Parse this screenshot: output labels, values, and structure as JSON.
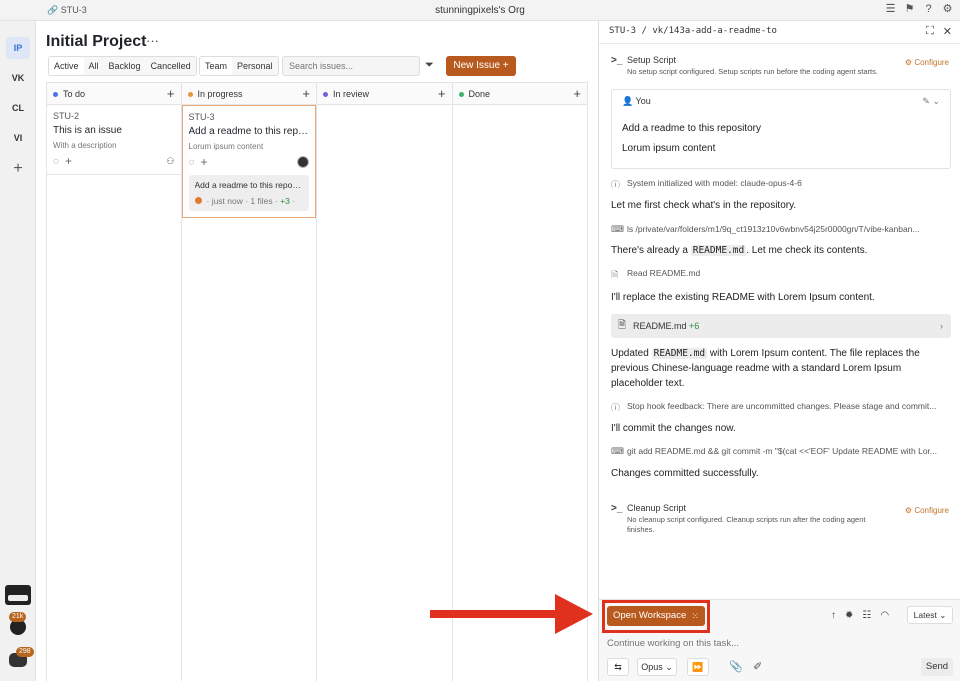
{
  "topbar": {
    "crumb": "STU-3",
    "org": "stunningpixels's Org",
    "icons": [
      "menu-icon",
      "flag-icon",
      "help-icon",
      "settings-icon"
    ]
  },
  "rail": {
    "items": [
      "IP",
      "VK",
      "CL",
      "VI"
    ],
    "github_badge": "21k",
    "discord_badge": "298"
  },
  "board": {
    "title": "Initial Project",
    "menu": "···",
    "filters": [
      "Active",
      "All",
      "Backlog",
      "Cancelled"
    ],
    "scope": [
      "Team",
      "Personal"
    ],
    "search_placeholder": "Search issues...",
    "new_issue": "New Issue +",
    "columns": [
      {
        "name": "To do",
        "color": "#4a72e8"
      },
      {
        "name": "In progress",
        "color": "#e8963a"
      },
      {
        "name": "In review",
        "color": "#7a5cd8"
      },
      {
        "name": "Done",
        "color": "#3bb36a"
      }
    ],
    "card1": {
      "id": "STU-2",
      "title": "This is an issue",
      "desc": "With a description"
    },
    "card2": {
      "id": "STU-3",
      "title": "Add a readme to this repository",
      "desc": "Lorum ipsum content",
      "sub_title": "Add a readme to this repository",
      "sub_meta": "· just now · 1 files ·",
      "sub_add": "+3",
      "sub_tail": "·"
    }
  },
  "panel": {
    "header": "STU-3 / vk/143a-add-a-readme-to",
    "setup_title": "Setup Script",
    "setup_desc": "No setup script configured. Setup scripts run before the coding agent starts.",
    "configure": "Configure",
    "you_label": "You",
    "you_line1": "Add a readme to this repository",
    "you_line2": "Lorum ipsum content",
    "sys1": "System initialized with model: claude-opus-4-6",
    "msg1": "Let me first check what's in the repository.",
    "cmd1": "ls /private/var/folders/m1/9q_ct1913z10v6wbnv54j25r0000gn/T/vibe-kanban...",
    "msg2a": "There's already a",
    "msg2code": "README.md",
    "msg2b": ". Let me check its contents.",
    "read1": "Read README.md",
    "msg3": "I'll replace the existing README with Lorem Ipsum content.",
    "file_name": "README.md",
    "file_add": "+6",
    "msg4a": "Updated",
    "msg4code": "README.md",
    "msg4b": "with Lorem Ipsum content. The file replaces the previous Chinese-language readme with a standard Lorem Ipsum placeholder text.",
    "hook": "Stop hook feedback: There are uncommitted changes. Please stage and commit...",
    "msg5": "I'll commit the changes now.",
    "cmd2": "git add README.md && git commit -m \"$(cat <<'EOF' Update README with Lor...",
    "msg6": "Changes committed successfully.",
    "cleanup_title": "Cleanup Script",
    "cleanup_desc": "No cleanup script configured. Cleanup scripts run after the coding agent finishes.",
    "open_ws": "Open Workspace",
    "latest": "Latest ⌄",
    "continue_placeholder": "Continue working on this task...",
    "model": "Opus ⌄",
    "send": "Send"
  }
}
